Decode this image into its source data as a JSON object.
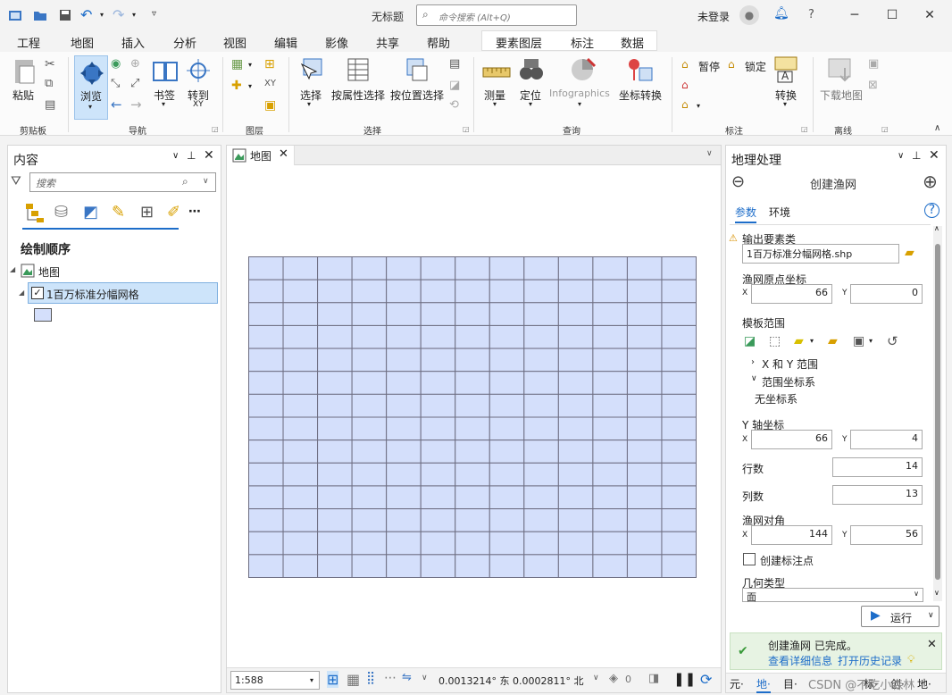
{
  "window": {
    "title": "无标题",
    "search_placeholder": "命令搜索 (Alt+Q)",
    "signin": "未登录"
  },
  "tabs": [
    "工程",
    "地图",
    "插入",
    "分析",
    "视图",
    "编辑",
    "影像",
    "共享",
    "帮助"
  ],
  "feature_tabs": [
    "要素图层",
    "标注",
    "数据"
  ],
  "ribbon": {
    "clipboard": {
      "paste": "粘贴",
      "group": "剪贴板"
    },
    "navigate": {
      "explore": "浏览",
      "bookmarks": "书签",
      "goto": "转到",
      "goto_sub": "XY",
      "group": "导航"
    },
    "layer": {
      "group": "图层"
    },
    "selection": {
      "select": "选择",
      "by_attr": "按属性选择",
      "by_loc": "按位置选择",
      "group": "选择"
    },
    "inquiry": {
      "measure": "测量",
      "locate": "定位",
      "infographics": "Infographics",
      "coord": "坐标转换",
      "group": "查询"
    },
    "labeling": {
      "pause": "暂停",
      "lock": "锁定",
      "convert": "转换",
      "group": "标注"
    },
    "offline": {
      "download": "下载地图",
      "group": "离线"
    }
  },
  "contents": {
    "title": "内容",
    "search_placeholder": "搜索",
    "draw_order": "绘制顺序",
    "map_node": "地图",
    "layer": "1百万标准分幅网格"
  },
  "mapview": {
    "tab": "地图",
    "grid": {
      "rows": 14,
      "cols": 13,
      "fill": "#d4dffb",
      "stroke": "#6e6e82"
    },
    "scale": "1:588",
    "coords": "0.0013214° 东 0.0002811° 北",
    "sel_count": "0"
  },
  "geoprocessing": {
    "title": "地理处理",
    "tool": "创建渔网",
    "tab_params": "参数",
    "tab_env": "环境",
    "output_label": "输出要素类",
    "output_value": "1百万标准分幅网格.shp",
    "origin_label": "渔网原点坐标",
    "origin_x": "66",
    "origin_y": "0",
    "template_label": "模板范围",
    "xy_range": "X 和 Y 范围",
    "range_cs": "范围坐标系",
    "no_cs": "无坐标系",
    "yaxis_label": "Y 轴坐标",
    "yaxis_x": "66",
    "yaxis_y": "4",
    "rows_label": "行数",
    "rows": "14",
    "cols_label": "列数",
    "cols": "13",
    "corner_label": "渔网对角",
    "corner_x": "144",
    "corner_y": "56",
    "label_points": "创建标注点",
    "geom_label": "几何类型",
    "geom_value": "面",
    "run": "运行",
    "done": "创建渔网 已完成。",
    "details": "查看详细信息",
    "history": "打开历史记录"
  },
  "bottom_tabs": [
    "元·",
    "地·",
    "目·",
    "标·",
    "创·",
    "地·"
  ],
  "watermark": "CSDN @不吃小森林",
  "colors": {
    "accent": "#1d6dc9",
    "grid_fill": "#d4dffb"
  }
}
